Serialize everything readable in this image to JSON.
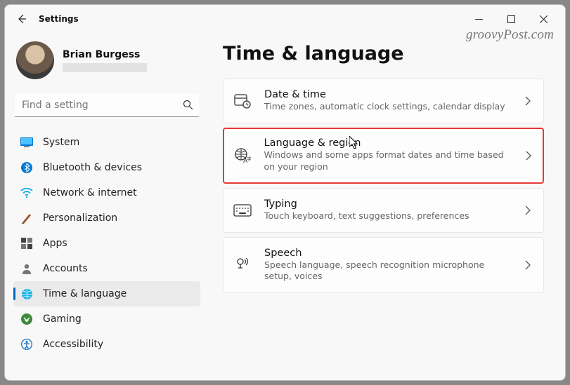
{
  "app_title": "Settings",
  "watermark": "groovyPost.com",
  "profile": {
    "name": "Brian Burgess"
  },
  "search": {
    "placeholder": "Find a setting"
  },
  "sidebar": {
    "items": [
      {
        "label": "System"
      },
      {
        "label": "Bluetooth & devices"
      },
      {
        "label": "Network & internet"
      },
      {
        "label": "Personalization"
      },
      {
        "label": "Apps"
      },
      {
        "label": "Accounts"
      },
      {
        "label": "Time & language"
      },
      {
        "label": "Gaming"
      },
      {
        "label": "Accessibility"
      }
    ]
  },
  "page": {
    "title": "Time & language",
    "cards": [
      {
        "title": "Date & time",
        "sub": "Time zones, automatic clock settings, calendar display"
      },
      {
        "title": "Language & region",
        "sub": "Windows and some apps format dates and time based on your region"
      },
      {
        "title": "Typing",
        "sub": "Touch keyboard, text suggestions, preferences"
      },
      {
        "title": "Speech",
        "sub": "Speech language, speech recognition microphone setup, voices"
      }
    ]
  }
}
